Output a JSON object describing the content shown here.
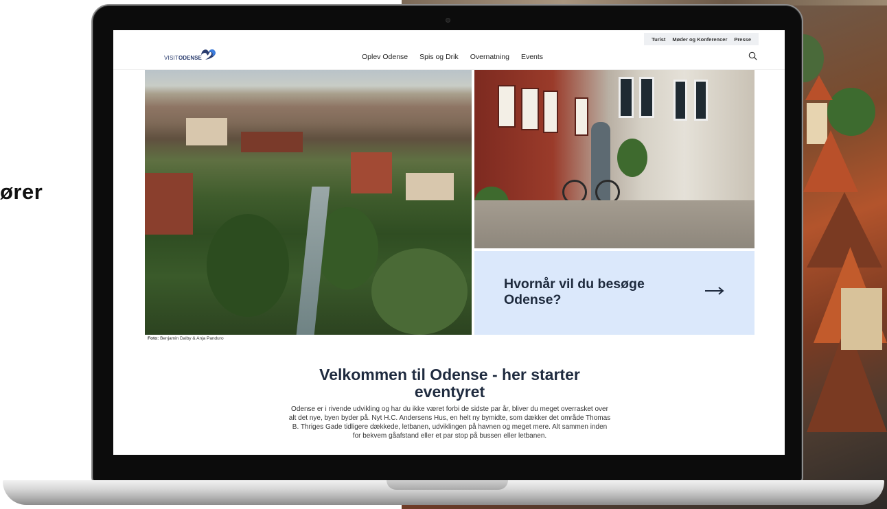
{
  "side_heading": "ører",
  "site": {
    "logo": {
      "part1": "VISIT",
      "part2": "ODENSE"
    },
    "utility_nav": [
      "Turist",
      "Møder og Konferencer",
      "Presse"
    ],
    "main_nav": [
      "Oplev Odense",
      "Spis og Drik",
      "Overnatning",
      "Events"
    ],
    "search_icon": "search-icon",
    "hero": {
      "cta_title": "Hvornår vil du besøge Odense?",
      "cta_arrow_icon": "arrow-right-icon",
      "photo_credit_label": "Foto:",
      "photo_credit_names": "Benjamin Dalby & Anja Panduro"
    },
    "welcome_title": "Velkommen til Odense - her starter eventyret",
    "intro_text": "Odense er i rivende udvikling og har du ikke været forbi de sidste par år, bliver du meget overrasket over alt det nye, byen byder på. Nyt H.C. Andersens Hus, en helt ny bymidte, som dækker det område Thomas B. Thriges Gade tidligere dækkede, letbanen, udviklingen på havnen og meget mere. Alt sammen inden for bekvem gåafstand eller et par stop på bussen eller letbanen."
  },
  "colors": {
    "cta_background": "#dbe8fb",
    "heading_text": "#1f2b3f",
    "brand_blue": "#2a3c6e"
  }
}
